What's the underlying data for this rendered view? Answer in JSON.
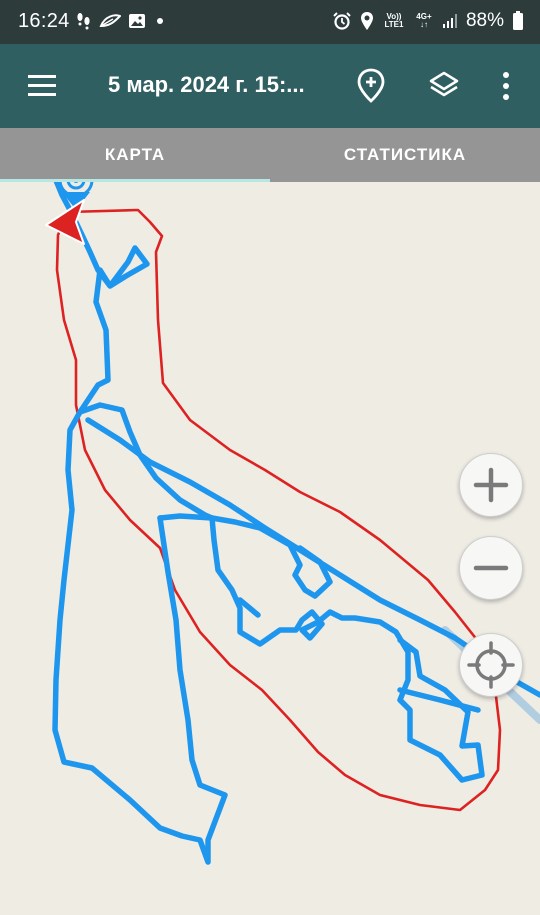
{
  "status_bar": {
    "time": "16:24",
    "left_icons": [
      "footsteps-icon",
      "leaf-icon",
      "image-icon",
      "dot-icon"
    ],
    "right_icons": [
      "alarm-icon",
      "location-icon",
      "volte-icon",
      "4g-icon",
      "signal-icon",
      "battery-icon"
    ],
    "volte_label_top": "Vo))",
    "volte_label_bottom": "LTE1",
    "network_label": "4G+",
    "battery_percent": "88%"
  },
  "app_bar": {
    "title": "5 мар. 2024 г. 15:...",
    "menu_icon": "hamburger-menu-icon",
    "add_marker_icon": "add-location-icon",
    "layers_icon": "layers-icon",
    "more_icon": "more-vert-icon"
  },
  "tabs": [
    {
      "label": "КАРТА",
      "active": true
    },
    {
      "label": "СТАТИСТИКА",
      "active": false
    }
  ],
  "map": {
    "track_color": "#1e96ee",
    "boundary_color": "#dd2222",
    "controls": [
      "zoom-in-icon",
      "zoom-out-icon",
      "my-location-icon"
    ]
  }
}
